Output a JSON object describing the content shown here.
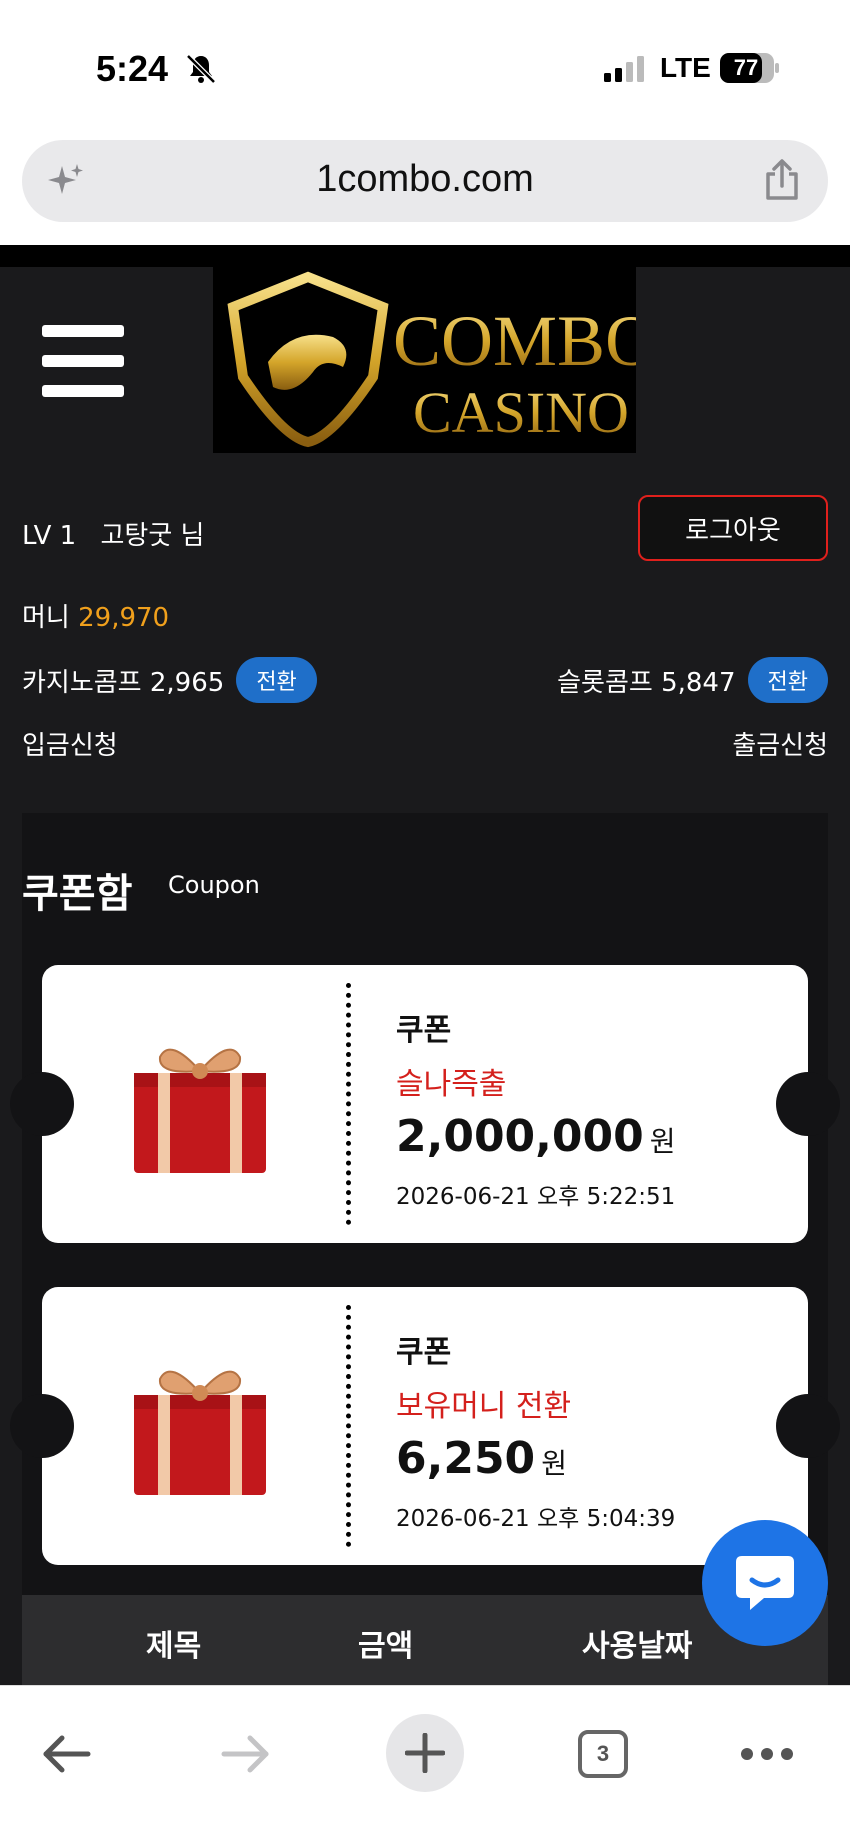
{
  "status_bar": {
    "time": "5:24",
    "network": "LTE",
    "battery": "77"
  },
  "browser": {
    "url": "1combo.com",
    "tab_count": "3"
  },
  "header": {
    "logo_line1": "COMBO",
    "logo_line2": "CASINO"
  },
  "user": {
    "level": "LV 1",
    "name": "고탕굿 님",
    "logout_label": "로그아웃"
  },
  "balance": {
    "money_label": "머니",
    "money_value": "29,970",
    "casino_comp_label": "카지노콤프 2,965",
    "slot_comp_label": "슬롯콤프 5,847",
    "convert_label": "전환",
    "deposit_label": "입금신청",
    "withdraw_label": "출금신청"
  },
  "coupon_box": {
    "title": "쿠폰함",
    "subtitle": "Coupon",
    "coupons": [
      {
        "label": "쿠폰",
        "type": "슬나즉출",
        "amount": "2,000,000",
        "unit": "원",
        "date": "2026-06-21 오후 5:22:51"
      },
      {
        "label": "쿠폰",
        "type": "보유머니 전환",
        "amount": "6,250",
        "unit": "원",
        "date": "2026-06-21 오후 5:04:39"
      }
    ],
    "table_headers": [
      "제목",
      "금액",
      "사용날짜"
    ]
  },
  "colors": {
    "accent_blue": "#1f6fc9",
    "money_gold": "#f0a01c",
    "alert_red": "#d4201c"
  }
}
